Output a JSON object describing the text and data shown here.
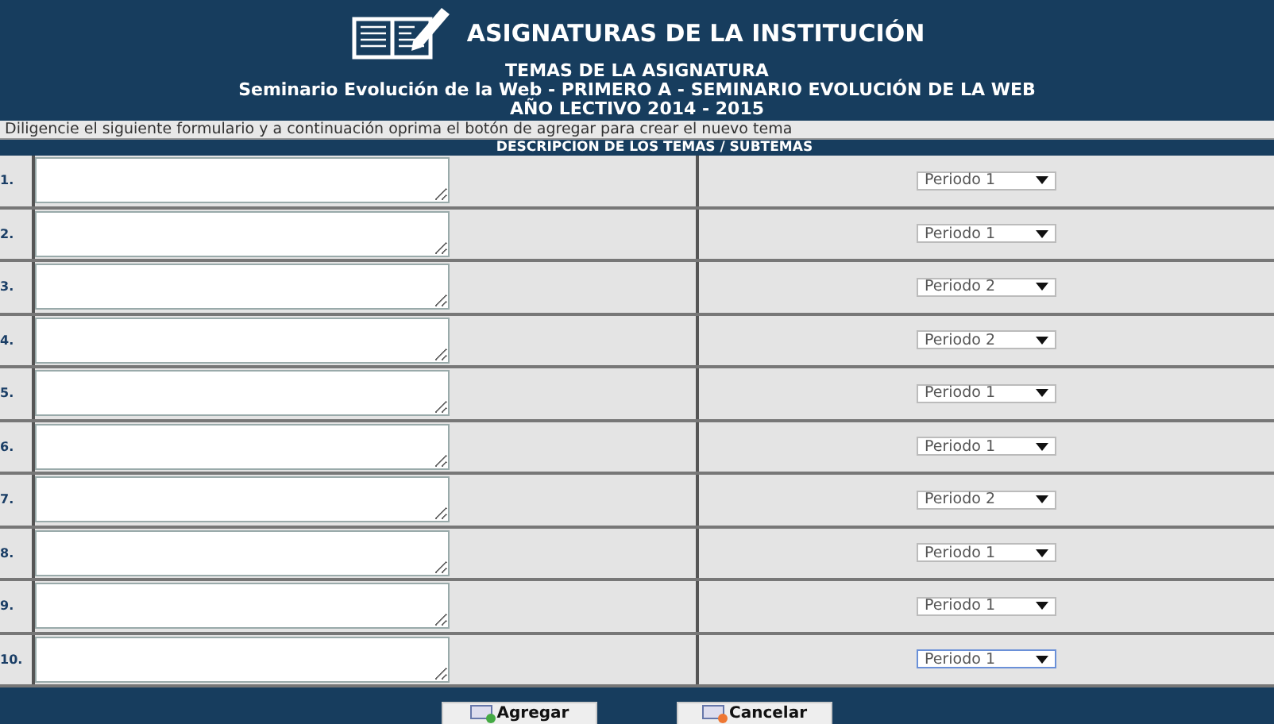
{
  "header": {
    "title": "ASIGNATURAS DE LA INSTITUCIÓN",
    "subtitle": "TEMAS DE LA ASIGNATURA",
    "course": "Seminario Evolución de la Web - PRIMERO A - SEMINARIO EVOLUCIÓN DE LA WEB",
    "year": "AÑO LECTIVO 2014 - 2015"
  },
  "instructions": "Diligencie el siguiente formulario y a continuación oprima el botón de agregar para crear el nuevo tema",
  "table": {
    "column_header": "DESCRIPCION DE LOS TEMAS / SUBTEMAS",
    "rows": [
      {
        "number": "1.",
        "period": "Periodo 1",
        "focused": false
      },
      {
        "number": "2.",
        "period": "Periodo 1",
        "focused": false
      },
      {
        "number": "3.",
        "period": "Periodo 2",
        "focused": false
      },
      {
        "number": "4.",
        "period": "Periodo 2",
        "focused": false
      },
      {
        "number": "5.",
        "period": "Periodo 1",
        "focused": false
      },
      {
        "number": "6.",
        "period": "Periodo 1",
        "focused": false
      },
      {
        "number": "7.",
        "period": "Periodo 2",
        "focused": false
      },
      {
        "number": "8.",
        "period": "Periodo 1",
        "focused": false
      },
      {
        "number": "9.",
        "period": "Periodo 1",
        "focused": false
      },
      {
        "number": "10.",
        "period": "Periodo 1",
        "focused": true
      }
    ]
  },
  "buttons": [
    {
      "label": "Agregar",
      "kind": "add"
    },
    {
      "label": "Cancelar",
      "kind": "cancel"
    }
  ]
}
